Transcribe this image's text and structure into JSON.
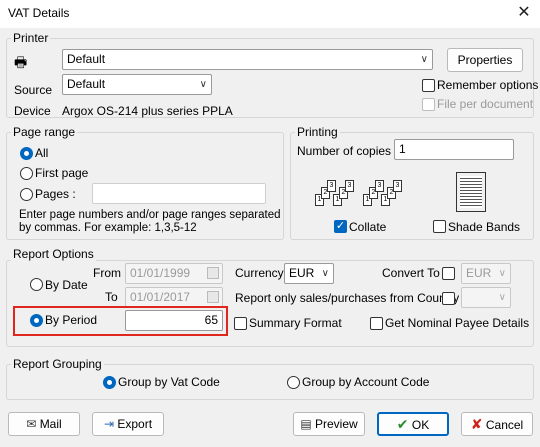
{
  "window": {
    "title": "VAT Details",
    "close_icon": "close-icon"
  },
  "printer": {
    "legend": "Printer",
    "printer_value": "Default",
    "properties_label": "Properties",
    "source_label": "Source",
    "source_value": "Default",
    "device_label": "Device",
    "device_value": "Argox OS-214 plus series PPLA",
    "remember_options_label": "Remember options",
    "file_per_document_label": "File per document"
  },
  "page_range": {
    "legend": "Page range",
    "all_label": "All",
    "first_page_label": "First page",
    "pages_label": "Pages :",
    "pages_value": "",
    "hint_line1": "Enter page numbers and/or page ranges separated",
    "hint_line2": "by commas. For example: 1,3,5-12"
  },
  "printing": {
    "legend": "Printing",
    "copies_label": "Number of copies",
    "copies_value": "1",
    "collate_label": "Collate",
    "shade_bands_label": "Shade Bands"
  },
  "report_options": {
    "legend": "Report Options",
    "by_date_label": "By Date",
    "from_label": "From",
    "from_value": "01/01/1999",
    "to_label": "To",
    "to_value": "01/01/2017",
    "by_period_label": "By Period",
    "period_value": "65",
    "currency_label": "Currency",
    "currency_value": "EUR",
    "convert_to_label": "Convert To",
    "convert_to_value": "EUR",
    "country_label": "Report only sales/purchases from Country",
    "country_value": "",
    "summary_format_label": "Summary Format",
    "nominal_payee_label": "Get Nominal Payee Details"
  },
  "report_grouping": {
    "legend": "Report Grouping",
    "group_vat_label": "Group by Vat Code",
    "group_account_label": "Group by Account Code"
  },
  "footer": {
    "mail_label": "Mail",
    "export_label": "Export",
    "preview_label": "Preview",
    "ok_label": "OK",
    "cancel_label": "Cancel"
  },
  "colors": {
    "accent": "#0067c0",
    "highlight": "#e0261d",
    "ok_check": "#2e8b2e",
    "cancel_x": "#d0201a"
  }
}
